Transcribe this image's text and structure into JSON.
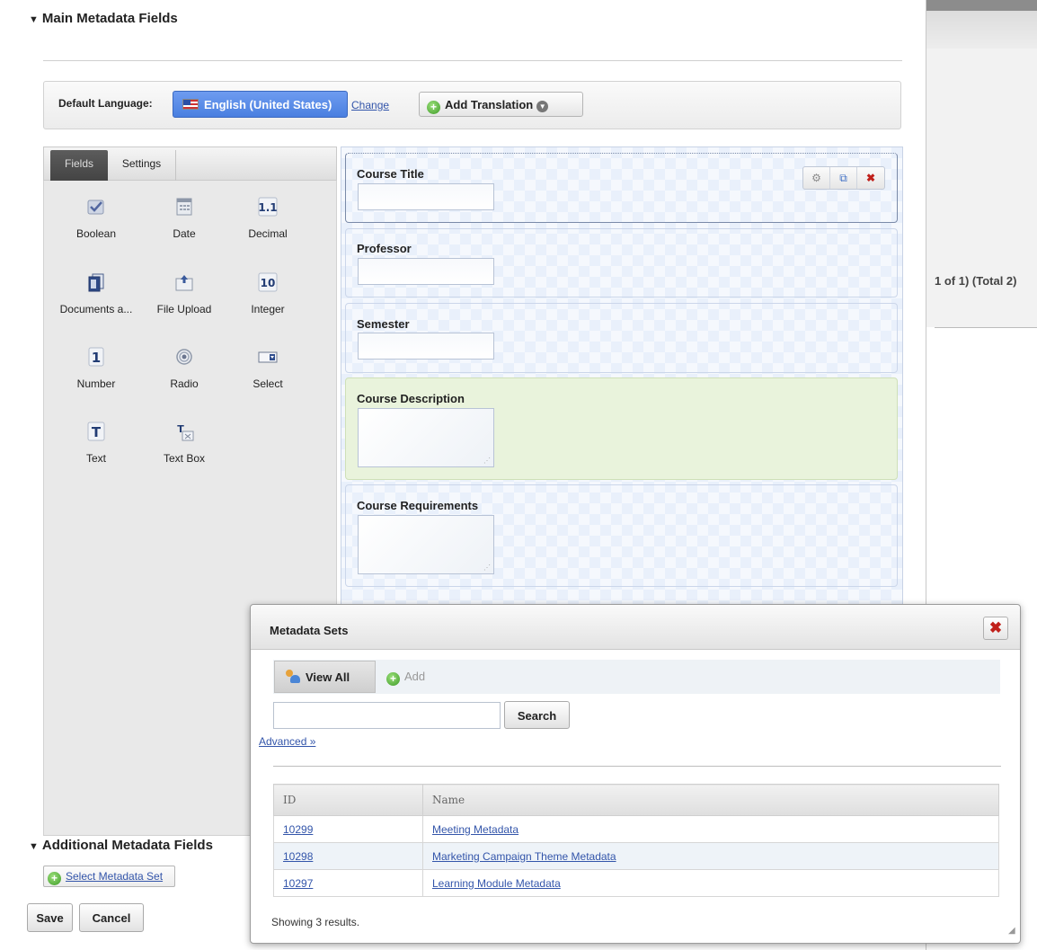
{
  "main_section": {
    "title": "Main Metadata Fields"
  },
  "language_bar": {
    "label": "Default Language:",
    "language": "English (United States)",
    "change_link": "Change",
    "add_translation": "Add Translation"
  },
  "palette": {
    "tabs": [
      {
        "label": "Fields",
        "active": true
      },
      {
        "label": "Settings",
        "active": false
      }
    ],
    "items": [
      {
        "label": "Boolean",
        "icon": "checkbox-icon"
      },
      {
        "label": "Date",
        "icon": "calendar-icon"
      },
      {
        "label": "Decimal",
        "icon": "decimal-icon"
      },
      {
        "label": "Documents a...",
        "icon": "documents-icon"
      },
      {
        "label": "File Upload",
        "icon": "file-upload-icon"
      },
      {
        "label": "Integer",
        "icon": "integer-icon"
      },
      {
        "label": "Number",
        "icon": "number-icon"
      },
      {
        "label": "Radio",
        "icon": "radio-icon"
      },
      {
        "label": "Select",
        "icon": "select-icon"
      },
      {
        "label": "Text",
        "icon": "text-icon"
      },
      {
        "label": "Text Box",
        "icon": "text-box-icon"
      }
    ]
  },
  "form_fields": [
    {
      "label": "Course Title",
      "type": "text"
    },
    {
      "label": "Professor",
      "type": "text"
    },
    {
      "label": "Semester",
      "type": "text"
    },
    {
      "label": "Course Description",
      "type": "textarea"
    },
    {
      "label": "Course Requirements",
      "type": "textarea"
    }
  ],
  "background_pager": "1 of 1) (Total 2)",
  "additional_section": {
    "title": "Additional Metadata Fields",
    "select_set": "Select Metadata Set"
  },
  "actions": {
    "save": "Save",
    "cancel": "Cancel"
  },
  "dialog": {
    "title": "Metadata Sets",
    "view_all": "View All",
    "add": "Add",
    "search_value": "",
    "search_button": "Search",
    "advanced": "Advanced »",
    "columns": [
      "ID",
      "Name"
    ],
    "rows": [
      {
        "id": "10299",
        "name": "Meeting Metadata"
      },
      {
        "id": "10298",
        "name": "Marketing Campaign Theme Metadata"
      },
      {
        "id": "10297",
        "name": "Learning Module Metadata"
      }
    ],
    "showing": "Showing 3 results."
  },
  "colors": {
    "language_chip": "#4a7fe0",
    "selected_field_green": "#e9f3dc",
    "close_red": "#c0201a"
  }
}
